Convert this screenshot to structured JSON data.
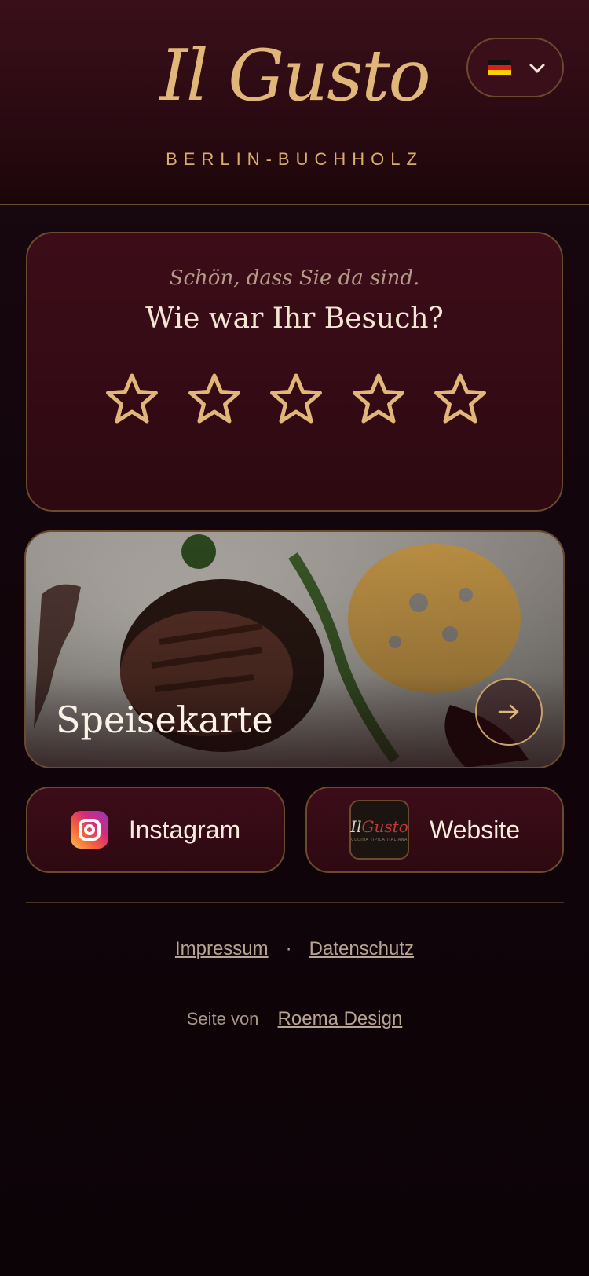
{
  "header": {
    "logo": "Il Gusto",
    "subtitle": "BERLIN-BUCHHOLZ",
    "language": {
      "flag": "germany-flag",
      "selected": "DE"
    }
  },
  "rating": {
    "greeting": "Schön, dass Sie da sind.",
    "question": "Wie war Ihr Besuch?",
    "stars_total": 5,
    "stars_selected": 0
  },
  "menu_card": {
    "label": "Speisekarte",
    "arrow": "arrow-right-icon"
  },
  "links": {
    "instagram": "Instagram",
    "website": "Website",
    "website_logo": "Il Gusto",
    "website_logo_tag": "CUCINA TIPICA ITALIANA"
  },
  "footer": {
    "impressum": "Impressum",
    "separator": "·",
    "datenschutz": "Datenschutz",
    "credit_prefix": "Seite von",
    "credit_link": "Roema Design"
  },
  "colors": {
    "accent_gold": "#e0b778",
    "card_bg": "#3c0d18",
    "page_bg": "#12050b"
  }
}
